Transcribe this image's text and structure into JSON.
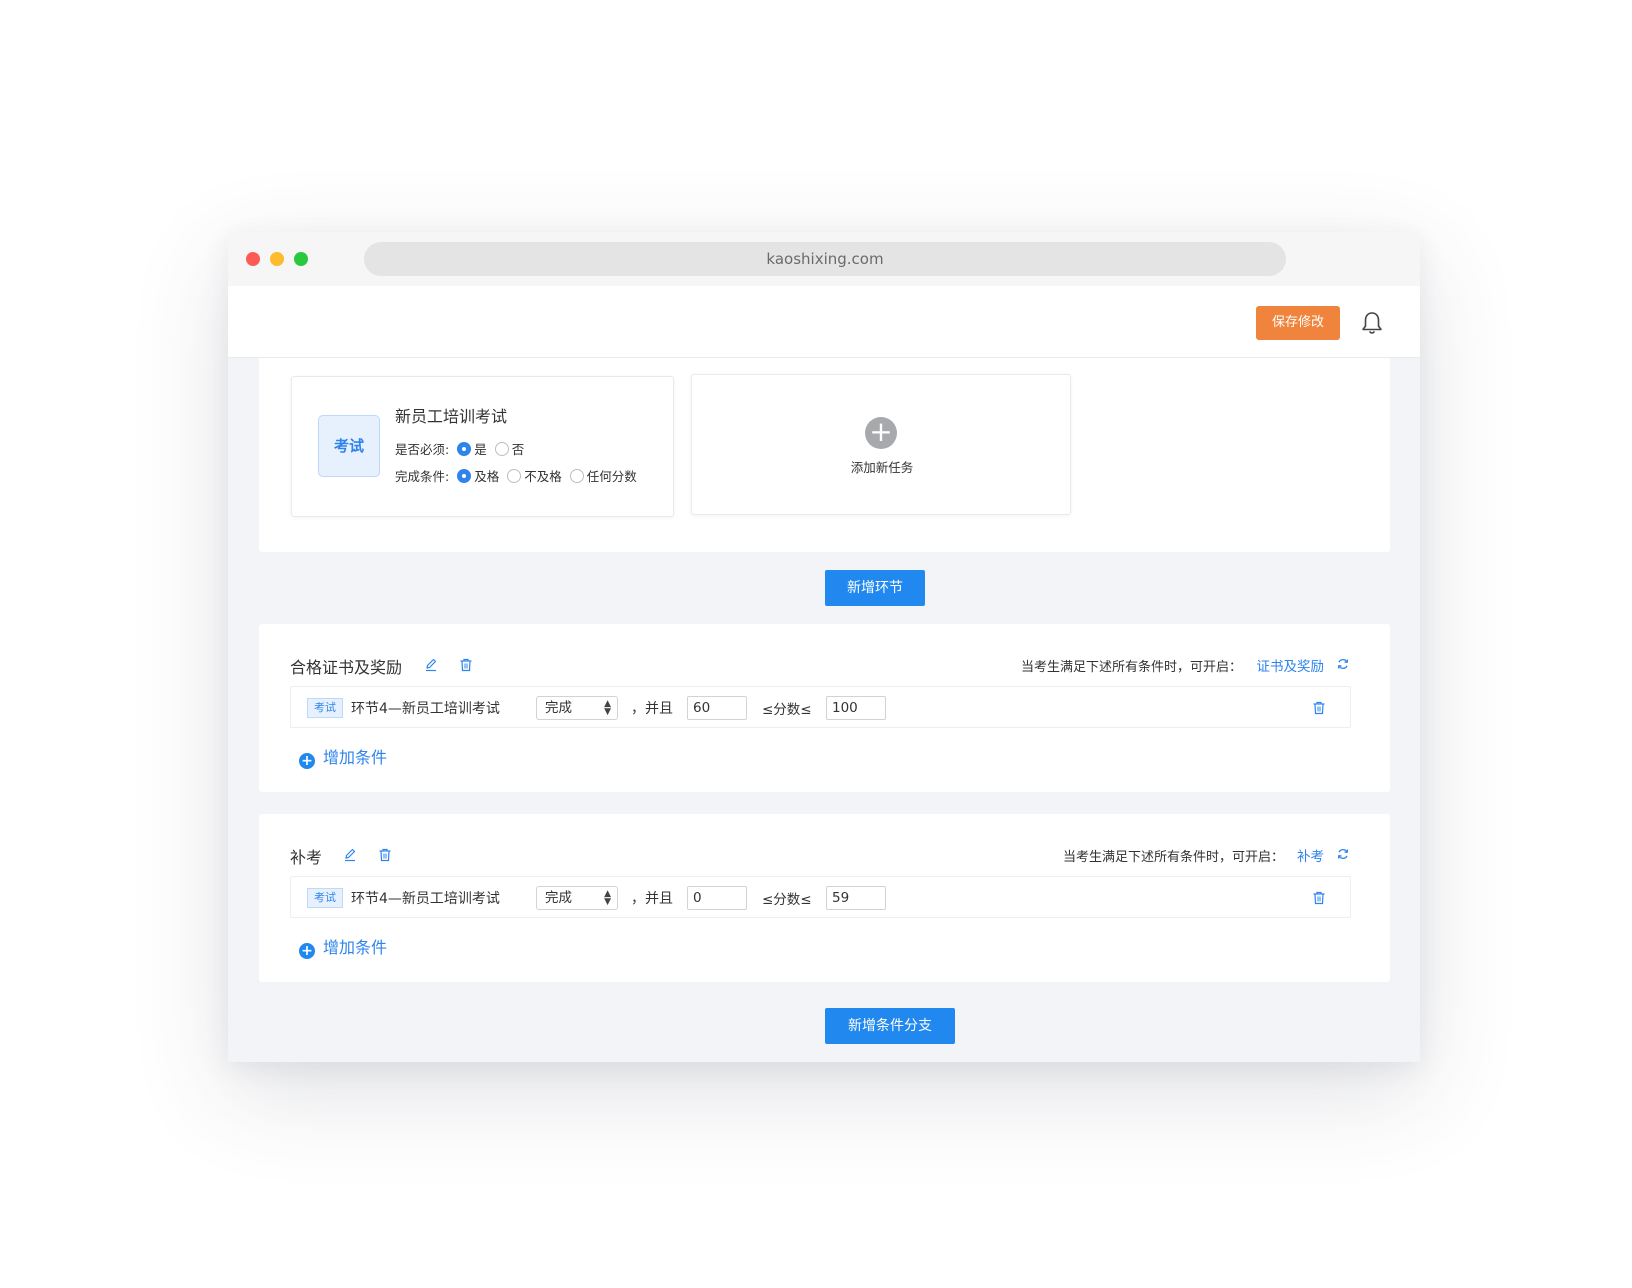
{
  "browser": {
    "url": "kaoshixing.com"
  },
  "header": {
    "save_label": "保存修改"
  },
  "stage": {
    "exam_task": {
      "badge": "考试",
      "title": "新员工培训考试",
      "required_label": "是否必须:",
      "required_options": [
        "是",
        "否"
      ],
      "required_selected": "是",
      "completion_label": "完成条件:",
      "completion_options": [
        "及格",
        "不及格",
        "任何分数"
      ],
      "completion_selected": "及格"
    },
    "add_task_label": "添加新任务"
  },
  "add_stage_label": "新增环节",
  "branches": [
    {
      "title": "合格证书及奖励",
      "condition_prefix": "当考生满足下述所有条件时，可开启：",
      "unlock_target": "证书及奖励",
      "conditions": [
        {
          "tag": "考试",
          "name": "环节4—新员工培训考试",
          "status": "完成",
          "and_text": "，并且",
          "min": "60",
          "score_text": "≤分数≤",
          "max": "100"
        }
      ],
      "add_condition_label": "增加条件"
    },
    {
      "title": "补考",
      "condition_prefix": "当考生满足下述所有条件时，可开启：",
      "unlock_target": "补考",
      "conditions": [
        {
          "tag": "考试",
          "name": "环节4—新员工培训考试",
          "status": "完成",
          "and_text": "，并且",
          "min": "0",
          "score_text": "≤分数≤",
          "max": "59"
        }
      ],
      "add_condition_label": "增加条件"
    }
  ],
  "add_branch_label": "新增条件分支",
  "colors": {
    "accent": "#2088ee",
    "save": "#f0843c",
    "badge_bg": "#e7f1fe"
  }
}
